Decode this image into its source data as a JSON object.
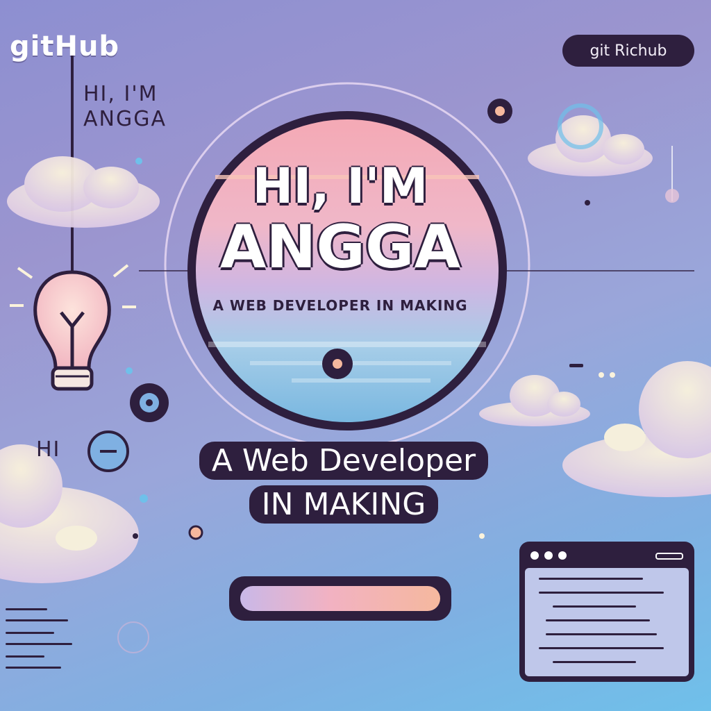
{
  "brand": {
    "left_logo": "gitHub",
    "right_logo": "git Richub"
  },
  "greeting": {
    "side_line1": "HI, I'M",
    "side_line2": "ANGGA",
    "hi_small": "HI"
  },
  "hero": {
    "line1": "HI, I'M",
    "line2": "ANGGA",
    "subtitle": "A WEB DEVELOPER IN MAKING"
  },
  "tagline": {
    "line1": "A Web Developer",
    "line2": "IN MAKING"
  },
  "colors": {
    "dark": "#2e1f3e",
    "background_top": "#8d8fd1",
    "background_bottom": "#6fc0ea",
    "sunset_pink": "#f2b2c2",
    "sunset_peach": "#f5b89e"
  },
  "icons": [
    "lightbulb-icon",
    "cloud-icon",
    "browser-window-icon",
    "toggle-icon",
    "sparkle-icon"
  ]
}
